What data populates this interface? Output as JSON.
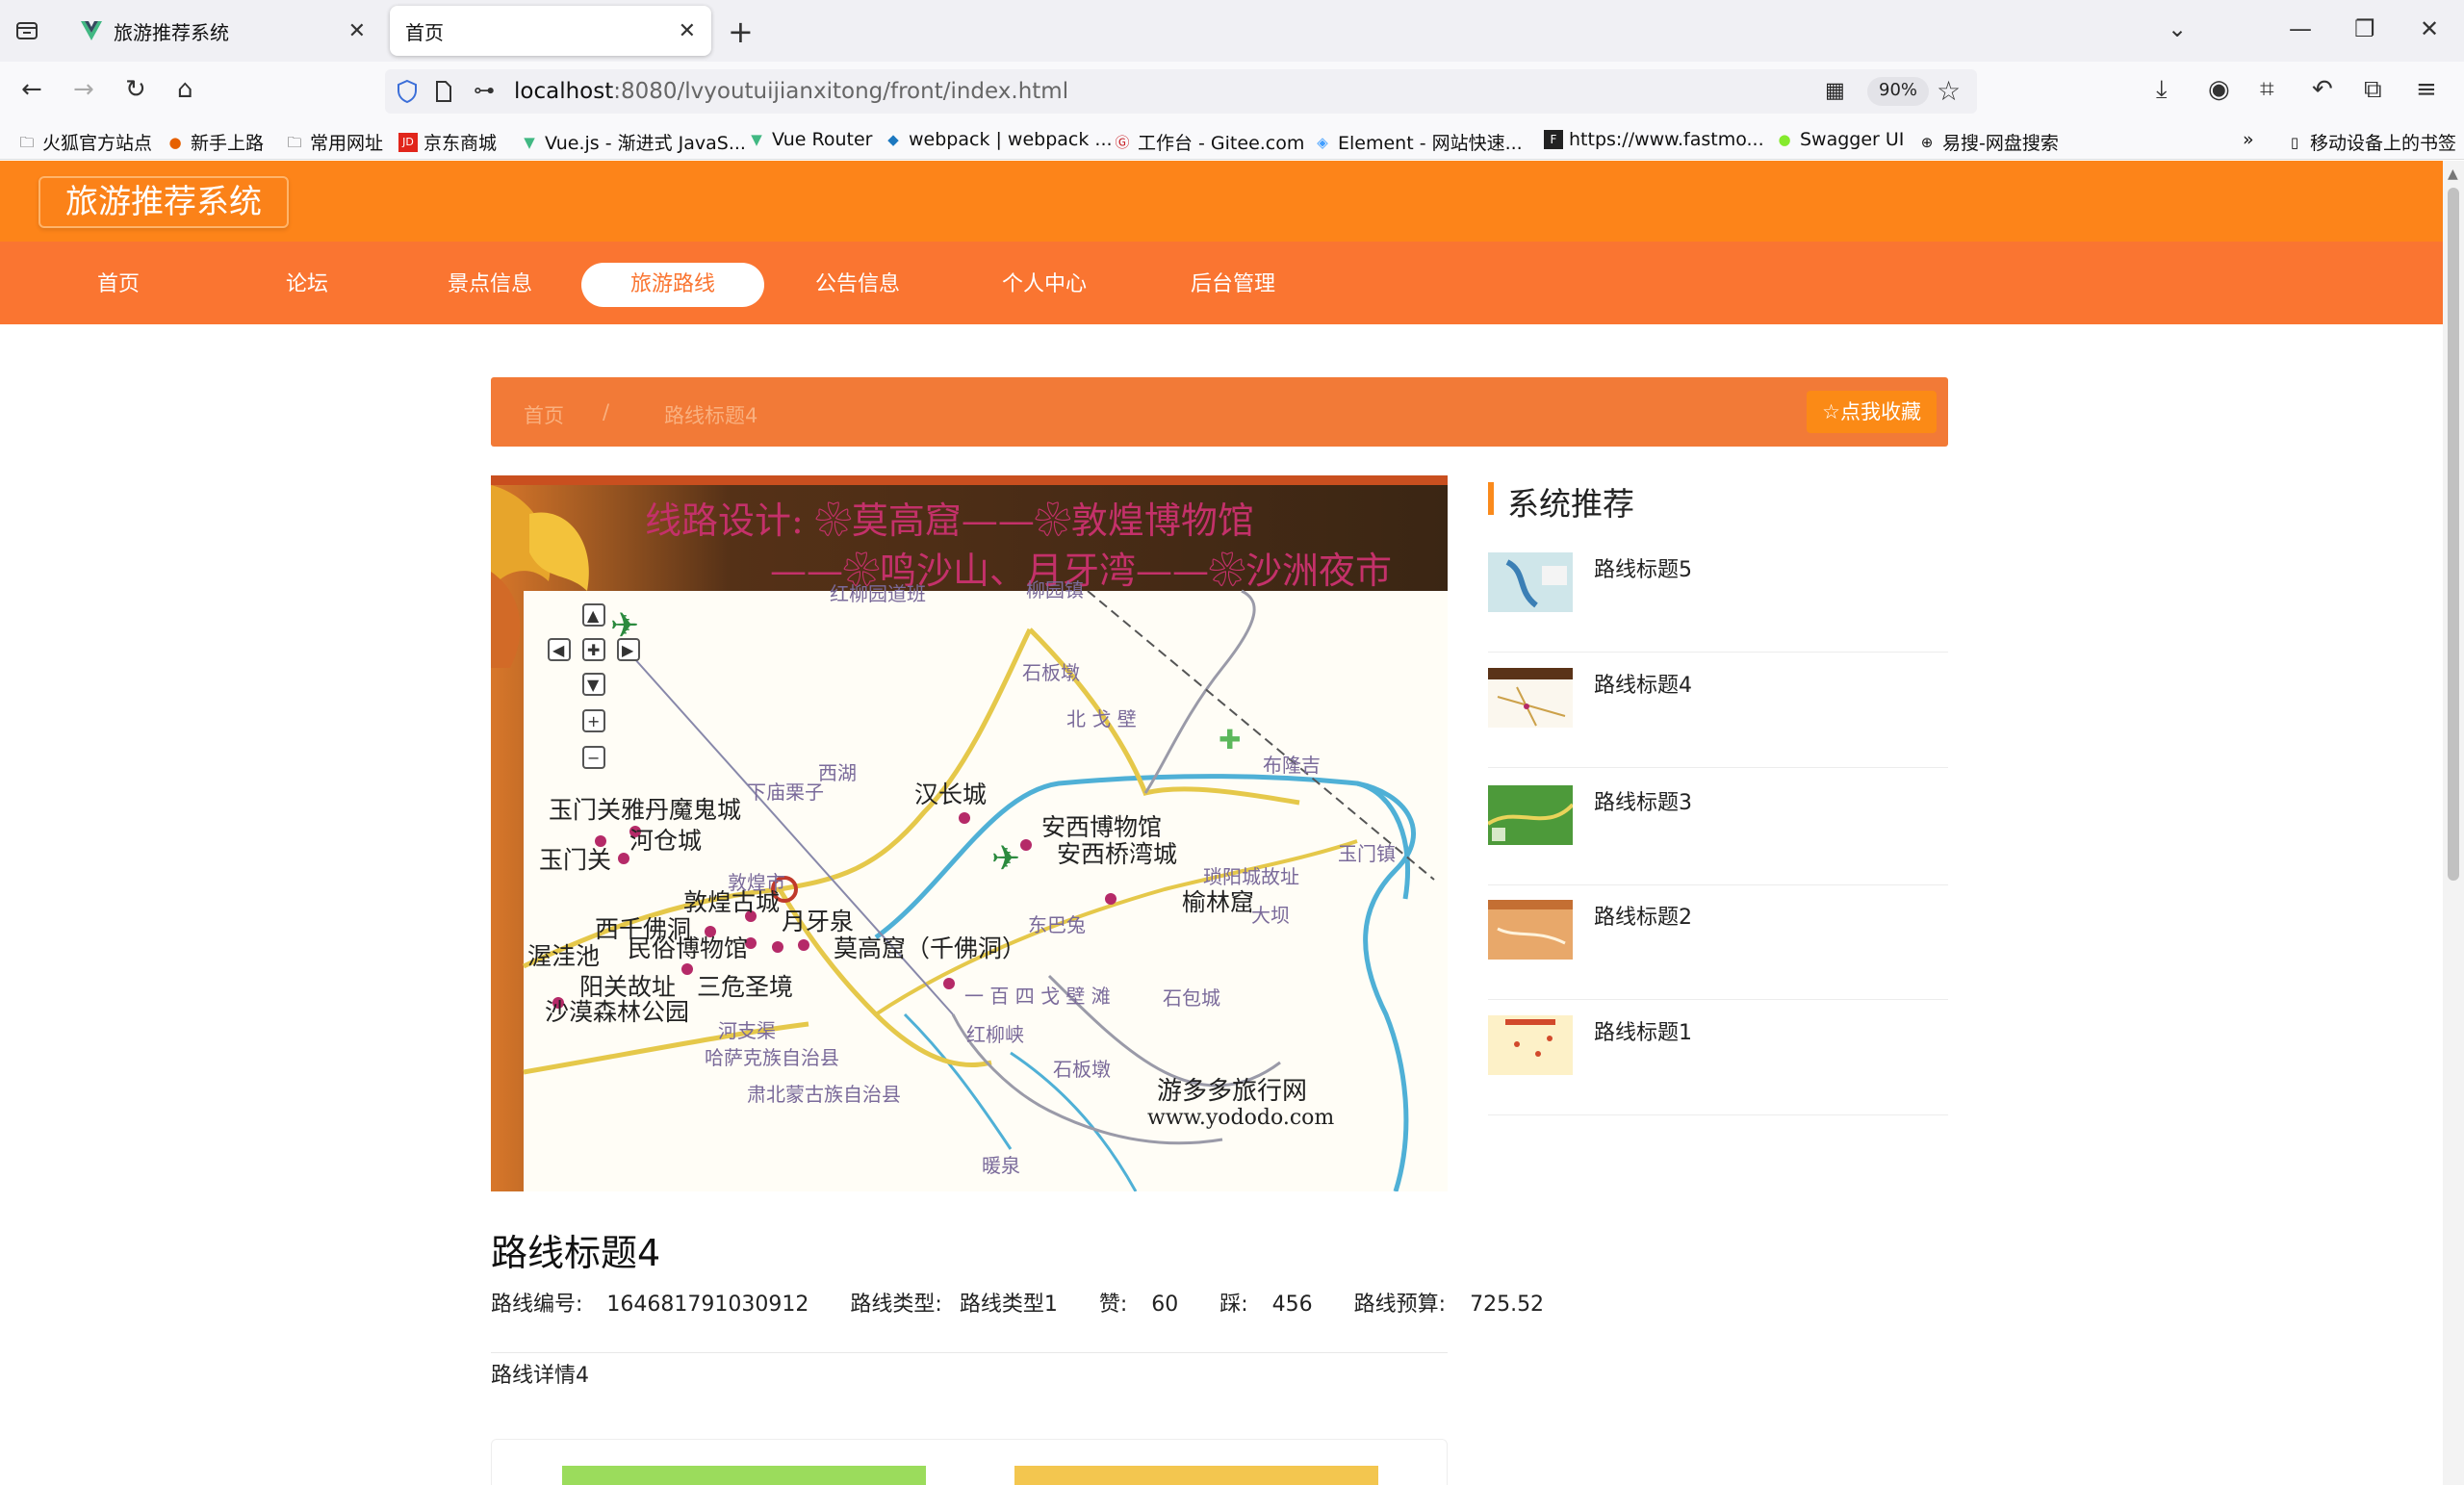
{
  "browser": {
    "tabs": [
      {
        "title": "旅游推荐系统",
        "active": false
      },
      {
        "title": "首页",
        "active": true
      }
    ],
    "url_host": "localhost",
    "url_path": ":8080/lvyoutuijianxitong/front/index.html",
    "zoom": "90%",
    "bookmarks": [
      "火狐官方站点",
      "新手上路",
      "常用网址",
      "京东商城",
      "Vue.js - 渐进式 JavaS...",
      "Vue Router",
      "webpack | webpack ...",
      "工作台 - Gitee.com",
      "Element - 网站快速...",
      "https://www.fastmo...",
      "Swagger UI",
      "易搜-网盘搜索"
    ],
    "mobile_bookmarks": "移动设备上的书签"
  },
  "site": {
    "logo": "旅游推荐系统",
    "nav": [
      "首页",
      "论坛",
      "景点信息",
      "旅游路线",
      "公告信息",
      "个人中心",
      "后台管理"
    ],
    "active_nav": "旅游路线"
  },
  "breadcrumb": {
    "home": "首页",
    "sep": "/",
    "current": "路线标题4",
    "collect": "点我收藏"
  },
  "detail": {
    "title": "路线标题4",
    "meta": {
      "code_label": "路线编号:",
      "code": "164681791030912",
      "type_label": "路线类型:",
      "type": "路线类型1",
      "like_label": "赞:",
      "like": "60",
      "dislike_label": "踩:",
      "dislike": "456",
      "budget_label": "路线预算:",
      "budget": "725.52"
    },
    "body": "路线详情4"
  },
  "map_image": {
    "banner_line1": "线路设计: ❀莫高窟——❀敦煌博物馆",
    "banner_line2": "——❀鸣沙山、月牙湾——❀沙洲夜市",
    "places": [
      "红柳园道班",
      "柳园镇",
      "石板墩",
      "北 戈 壁",
      "汉长城",
      "西湖",
      "下庙栗子",
      "玉门关雅丹魔鬼城",
      "河仓城",
      "玉门关",
      "安西博物馆",
      "安西桥湾城",
      "布隆吉",
      "敦煌市",
      "琐阳城故址",
      "榆林窟",
      "敦煌古城",
      "月牙泉",
      "西千佛洞",
      "民俗博物馆",
      "莫高窟（千佛洞）",
      "渥洼池",
      "阳关故址",
      "三危圣境",
      "沙漠森林公园",
      "一 百 四 戈 壁 滩",
      "石包城",
      "红柳峡",
      "哈萨克族自治县",
      "肃北蒙古族自治县",
      "石板墩",
      "暖泉",
      "玉门镇",
      "大坝",
      "东巴兔",
      "布隆吉",
      "河支渠",
      "鸣沙山"
    ],
    "watermark1": "游多多旅行网",
    "watermark2": "www.yododo.com"
  },
  "recommend": {
    "heading": "系统推荐",
    "items": [
      "路线标题5",
      "路线标题4",
      "路线标题3",
      "路线标题2",
      "路线标题1"
    ]
  }
}
